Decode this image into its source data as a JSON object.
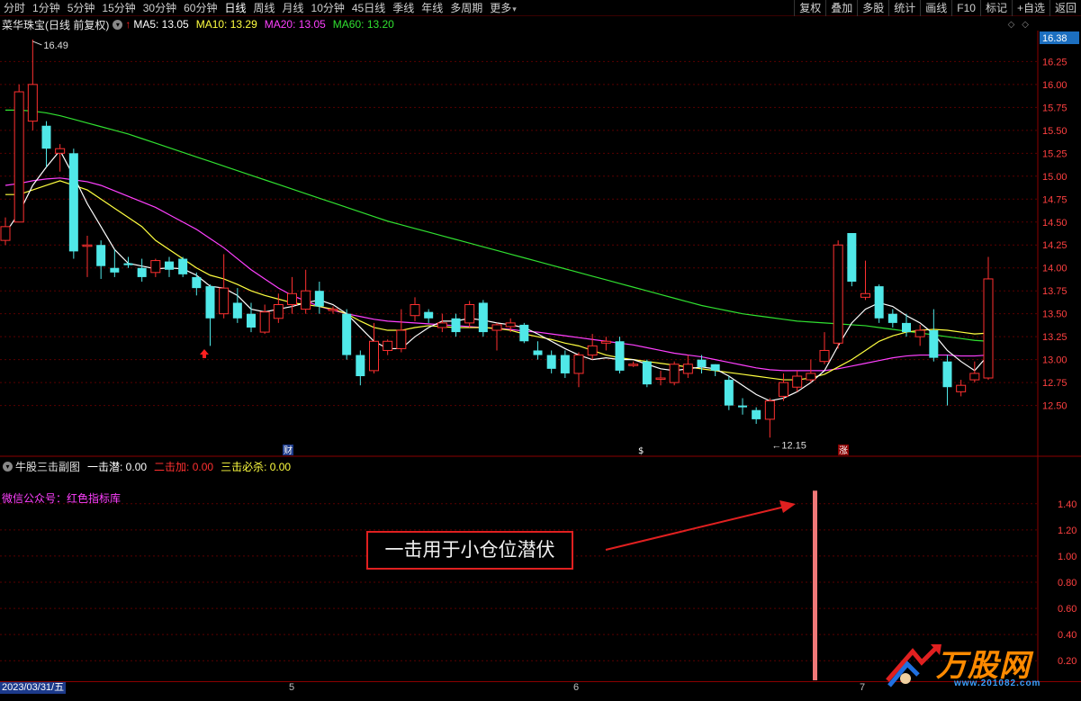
{
  "toolbar": {
    "periods": [
      "分时",
      "1分钟",
      "5分钟",
      "15分钟",
      "30分钟",
      "60分钟",
      "日线",
      "周线",
      "月线",
      "10分钟",
      "45日线",
      "季线",
      "年线",
      "多周期"
    ],
    "active_period": "日线",
    "more": "更多",
    "right_buttons": [
      "复权",
      "叠加",
      "多股",
      "统计",
      "画线",
      "F10",
      "标记",
      "+自选",
      "返回"
    ]
  },
  "stock": {
    "name": "菜华珠宝(日线 前复权)",
    "ma5": "MA5: 13.05",
    "ma10": "MA10: 13.29",
    "ma20": "MA20: 13.05",
    "ma60": "MA60: 13.20",
    "colors": {
      "ma5": "#ffffff",
      "ma10": "#ffff40",
      "ma20": "#ff40ff",
      "ma60": "#30e030",
      "up": "#ff3030",
      "down": "#50e8e8",
      "grid": "#5a0000"
    }
  },
  "main_chart": {
    "current_price_tag": "16.38",
    "price_axis": [
      "16.25",
      "16.00",
      "15.75",
      "15.50",
      "15.25",
      "15.00",
      "14.75",
      "14.50",
      "14.25",
      "14.00",
      "13.75",
      "13.50",
      "13.25",
      "13.00",
      "12.75",
      "12.50"
    ],
    "high_label": "16.49",
    "low_label": "12.15",
    "markers": {
      "cai": "财",
      "dollar": "$",
      "zhang": "涨"
    }
  },
  "sub_chart": {
    "title": "牛股三击副图",
    "yiji": "一击潜: 0.00",
    "erji": "二击加: 0.00",
    "sanji": "三击必杀: 0.00",
    "note": "微信公众号：红色指标库",
    "axis": [
      "1.40",
      "1.20",
      "1.00",
      "0.80",
      "0.60",
      "0.40",
      "0.20"
    ],
    "bar_value": 1.5
  },
  "callout": {
    "text": "一击用于小仓位潜伏"
  },
  "date_bar": {
    "first": "2023/03/31/五",
    "ticks": [
      "5",
      "6",
      "7"
    ]
  },
  "watermark": {
    "brand": "万股网",
    "url": "www.201082.com"
  },
  "chart_data": {
    "type": "candlestick",
    "ylim": [
      12.3,
      16.45
    ],
    "candles": [
      {
        "o": 14.3,
        "c": 14.45,
        "h": 14.55,
        "l": 14.25
      },
      {
        "o": 14.5,
        "c": 15.92,
        "h": 16.0,
        "l": 14.5
      },
      {
        "o": 15.6,
        "c": 16.0,
        "h": 16.49,
        "l": 15.5
      },
      {
        "o": 15.55,
        "c": 15.3,
        "h": 15.6,
        "l": 15.1
      },
      {
        "o": 15.25,
        "c": 15.3,
        "h": 15.35,
        "l": 15.05
      },
      {
        "o": 15.25,
        "c": 14.18,
        "h": 15.3,
        "l": 14.1
      },
      {
        "o": 14.25,
        "c": 14.25,
        "h": 14.35,
        "l": 13.9
      },
      {
        "o": 14.25,
        "c": 14.02,
        "h": 14.3,
        "l": 13.88
      },
      {
        "o": 14.0,
        "c": 13.95,
        "h": 14.2,
        "l": 13.9
      },
      {
        "o": 14.05,
        "c": 14.03,
        "h": 14.12,
        "l": 14.0
      },
      {
        "o": 14.0,
        "c": 13.9,
        "h": 14.1,
        "l": 13.85
      },
      {
        "o": 13.95,
        "c": 14.08,
        "h": 14.1,
        "l": 13.9
      },
      {
        "o": 14.07,
        "c": 13.98,
        "h": 14.12,
        "l": 13.9
      },
      {
        "o": 14.1,
        "c": 13.93,
        "h": 14.12,
        "l": 13.9
      },
      {
        "o": 13.9,
        "c": 13.78,
        "h": 13.95,
        "l": 13.7
      },
      {
        "o": 13.8,
        "c": 13.45,
        "h": 13.82,
        "l": 13.15
      },
      {
        "o": 13.5,
        "c": 13.78,
        "h": 14.15,
        "l": 13.45
      },
      {
        "o": 13.62,
        "c": 13.45,
        "h": 13.78,
        "l": 13.4
      },
      {
        "o": 13.5,
        "c": 13.35,
        "h": 13.62,
        "l": 13.3
      },
      {
        "o": 13.3,
        "c": 13.52,
        "h": 13.6,
        "l": 13.28
      },
      {
        "o": 13.45,
        "c": 13.6,
        "h": 13.72,
        "l": 13.4
      },
      {
        "o": 13.6,
        "c": 13.72,
        "h": 13.9,
        "l": 13.5
      },
      {
        "o": 13.55,
        "c": 13.75,
        "h": 13.98,
        "l": 13.5
      },
      {
        "o": 13.75,
        "c": 13.58,
        "h": 13.85,
        "l": 13.5
      },
      {
        "o": 13.55,
        "c": 13.55,
        "h": 13.58,
        "l": 13.5
      },
      {
        "o": 13.5,
        "c": 13.05,
        "h": 13.55,
        "l": 13.0
      },
      {
        "o": 13.05,
        "c": 12.82,
        "h": 13.1,
        "l": 12.72
      },
      {
        "o": 12.88,
        "c": 13.2,
        "h": 13.4,
        "l": 12.85
      },
      {
        "o": 13.1,
        "c": 13.2,
        "h": 13.22,
        "l": 13.05
      },
      {
        "o": 13.12,
        "c": 13.32,
        "h": 13.55,
        "l": 13.08
      },
      {
        "o": 13.48,
        "c": 13.6,
        "h": 13.68,
        "l": 13.42
      },
      {
        "o": 13.52,
        "c": 13.45,
        "h": 13.55,
        "l": 13.4
      },
      {
        "o": 13.35,
        "c": 13.4,
        "h": 13.5,
        "l": 13.3
      },
      {
        "o": 13.45,
        "c": 13.3,
        "h": 13.5,
        "l": 13.25
      },
      {
        "o": 13.4,
        "c": 13.6,
        "h": 13.64,
        "l": 13.35
      },
      {
        "o": 13.62,
        "c": 13.3,
        "h": 13.65,
        "l": 13.25
      },
      {
        "o": 13.32,
        "c": 13.38,
        "h": 13.4,
        "l": 13.1
      },
      {
        "o": 13.36,
        "c": 13.4,
        "h": 13.45,
        "l": 13.3
      },
      {
        "o": 13.38,
        "c": 13.2,
        "h": 13.4,
        "l": 13.18
      },
      {
        "o": 13.1,
        "c": 13.05,
        "h": 13.2,
        "l": 13.0
      },
      {
        "o": 13.05,
        "c": 12.9,
        "h": 13.1,
        "l": 12.85
      },
      {
        "o": 13.05,
        "c": 12.85,
        "h": 13.1,
        "l": 12.8
      },
      {
        "o": 12.85,
        "c": 13.05,
        "h": 13.08,
        "l": 12.7
      },
      {
        "o": 13.05,
        "c": 13.15,
        "h": 13.28,
        "l": 13.0
      },
      {
        "o": 13.18,
        "c": 13.2,
        "h": 13.25,
        "l": 13.1
      },
      {
        "o": 13.2,
        "c": 12.88,
        "h": 13.25,
        "l": 12.85
      },
      {
        "o": 12.95,
        "c": 12.95,
        "h": 12.98,
        "l": 12.92
      },
      {
        "o": 12.98,
        "c": 12.73,
        "h": 13.0,
        "l": 12.7
      },
      {
        "o": 12.8,
        "c": 12.8,
        "h": 12.88,
        "l": 12.72
      },
      {
        "o": 12.75,
        "c": 12.95,
        "h": 12.98,
        "l": 12.72
      },
      {
        "o": 12.85,
        "c": 12.95,
        "h": 13.05,
        "l": 12.8
      },
      {
        "o": 13.0,
        "c": 12.92,
        "h": 13.05,
        "l": 12.85
      },
      {
        "o": 12.95,
        "c": 12.88,
        "h": 12.95,
        "l": 12.82
      },
      {
        "o": 12.78,
        "c": 12.5,
        "h": 12.82,
        "l": 12.45
      },
      {
        "o": 12.5,
        "c": 12.48,
        "h": 12.58,
        "l": 12.4
      },
      {
        "o": 12.45,
        "c": 12.35,
        "h": 12.48,
        "l": 12.3
      },
      {
        "o": 12.35,
        "c": 12.55,
        "h": 12.58,
        "l": 12.15
      },
      {
        "o": 12.6,
        "c": 12.75,
        "h": 12.85,
        "l": 12.55
      },
      {
        "o": 12.7,
        "c": 12.82,
        "h": 12.88,
        "l": 12.65
      },
      {
        "o": 12.78,
        "c": 12.85,
        "h": 13.0,
        "l": 12.75
      },
      {
        "o": 12.98,
        "c": 13.1,
        "h": 13.3,
        "l": 12.95
      },
      {
        "o": 13.18,
        "c": 14.25,
        "h": 14.3,
        "l": 13.12
      },
      {
        "o": 14.38,
        "c": 13.85,
        "h": 14.38,
        "l": 13.8
      },
      {
        "o": 13.68,
        "c": 13.72,
        "h": 14.08,
        "l": 13.65
      },
      {
        "o": 13.8,
        "c": 13.45,
        "h": 13.82,
        "l": 13.4
      },
      {
        "o": 13.5,
        "c": 13.4,
        "h": 13.55,
        "l": 13.35
      },
      {
        "o": 13.4,
        "c": 13.3,
        "h": 13.5,
        "l": 13.25
      },
      {
        "o": 13.25,
        "c": 13.32,
        "h": 13.38,
        "l": 13.15
      },
      {
        "o": 13.32,
        "c": 13.02,
        "h": 13.55,
        "l": 12.98
      },
      {
        "o": 12.98,
        "c": 12.7,
        "h": 13.05,
        "l": 12.5
      },
      {
        "o": 12.65,
        "c": 12.72,
        "h": 12.78,
        "l": 12.6
      },
      {
        "o": 12.78,
        "c": 12.85,
        "h": 12.98,
        "l": 12.75
      },
      {
        "o": 12.8,
        "c": 13.88,
        "h": 14.12,
        "l": 12.78
      }
    ],
    "ma5": [
      14.38,
      14.6,
      14.9,
      15.1,
      15.28,
      15.0,
      14.7,
      14.45,
      14.2,
      14.05,
      14.02,
      13.99,
      14.0,
      13.99,
      13.92,
      13.8,
      13.78,
      13.7,
      13.55,
      13.52,
      13.55,
      13.58,
      13.62,
      13.65,
      13.6,
      13.5,
      13.35,
      13.2,
      13.12,
      13.12,
      13.25,
      13.35,
      13.42,
      13.42,
      13.45,
      13.43,
      13.4,
      13.38,
      13.35,
      13.28,
      13.2,
      13.12,
      13.05,
      13.0,
      13.02,
      13.0,
      13.0,
      12.95,
      12.9,
      12.88,
      12.9,
      12.92,
      12.9,
      12.82,
      12.72,
      12.62,
      12.55,
      12.58,
      12.65,
      12.75,
      12.88,
      13.15,
      13.4,
      13.55,
      13.62,
      13.58,
      13.48,
      13.4,
      13.28,
      13.1,
      12.98,
      12.88,
      13.05
    ],
    "ma10": [
      14.8,
      14.8,
      14.85,
      14.9,
      14.95,
      14.9,
      14.85,
      14.75,
      14.65,
      14.55,
      14.45,
      14.3,
      14.2,
      14.1,
      14.0,
      13.92,
      13.88,
      13.82,
      13.75,
      13.7,
      13.66,
      13.62,
      13.6,
      13.58,
      13.55,
      13.5,
      13.42,
      13.35,
      13.32,
      13.32,
      13.35,
      13.37,
      13.36,
      13.35,
      13.35,
      13.35,
      13.34,
      13.32,
      13.28,
      13.25,
      13.22,
      13.18,
      13.15,
      13.1,
      13.05,
      13.02,
      13.0,
      12.98,
      12.96,
      12.94,
      12.92,
      12.9,
      12.88,
      12.86,
      12.84,
      12.82,
      12.8,
      12.78,
      12.78,
      12.8,
      12.84,
      12.92,
      13.0,
      13.1,
      13.2,
      13.26,
      13.3,
      13.32,
      13.33,
      13.32,
      13.3,
      13.28,
      13.29
    ],
    "ma20": [
      14.9,
      14.92,
      14.95,
      14.97,
      14.98,
      14.96,
      14.94,
      14.9,
      14.84,
      14.78,
      14.72,
      14.66,
      14.58,
      14.5,
      14.42,
      14.32,
      14.22,
      14.1,
      13.98,
      13.88,
      13.78,
      13.7,
      13.64,
      13.58,
      13.54,
      13.5,
      13.47,
      13.44,
      13.42,
      13.41,
      13.4,
      13.39,
      13.38,
      13.37,
      13.36,
      13.35,
      13.34,
      13.33,
      13.31,
      13.3,
      13.28,
      13.26,
      13.24,
      13.22,
      13.2,
      13.18,
      13.16,
      13.13,
      13.1,
      13.07,
      13.05,
      13.03,
      13.0,
      12.97,
      12.94,
      12.91,
      12.89,
      12.88,
      12.88,
      12.88,
      12.88,
      12.9,
      12.93,
      12.96,
      12.99,
      13.02,
      13.04,
      13.05,
      13.05,
      13.05,
      13.04,
      13.04,
      13.05
    ],
    "ma60": [
      15.72,
      15.72,
      15.71,
      15.69,
      15.66,
      15.62,
      15.58,
      15.54,
      15.5,
      15.46,
      15.41,
      15.36,
      15.31,
      15.26,
      15.21,
      15.16,
      15.11,
      15.06,
      15.01,
      14.96,
      14.91,
      14.86,
      14.81,
      14.76,
      14.71,
      14.66,
      14.61,
      14.56,
      14.51,
      14.47,
      14.43,
      14.39,
      14.35,
      14.31,
      14.27,
      14.23,
      14.19,
      14.15,
      14.11,
      14.07,
      14.03,
      13.99,
      13.95,
      13.91,
      13.87,
      13.83,
      13.79,
      13.75,
      13.71,
      13.67,
      13.63,
      13.59,
      13.56,
      13.53,
      13.5,
      13.48,
      13.46,
      13.44,
      13.42,
      13.41,
      13.4,
      13.39,
      13.38,
      13.37,
      13.35,
      13.33,
      13.31,
      13.29,
      13.27,
      13.25,
      13.23,
      13.21,
      13.2
    ]
  }
}
